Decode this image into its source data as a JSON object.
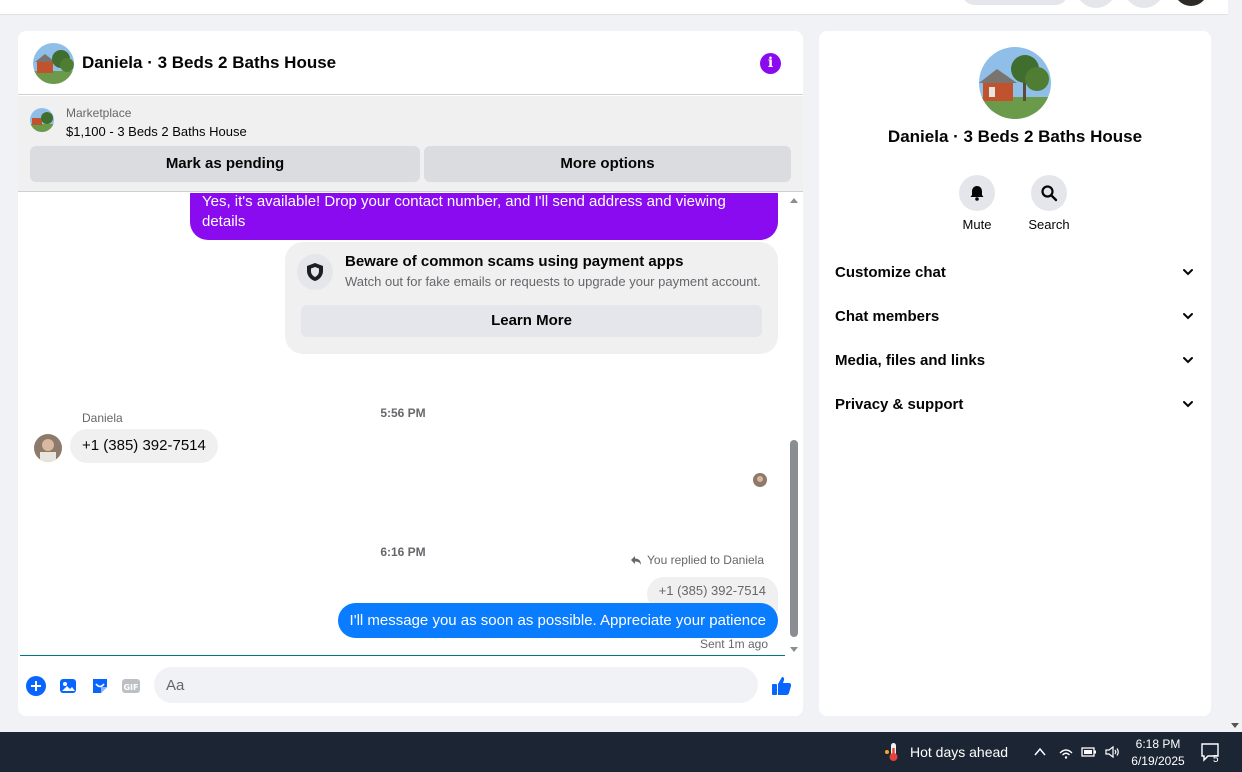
{
  "chat": {
    "title": "Daniela · 3 Beds 2 Baths House",
    "marketplace": {
      "label": "Marketplace",
      "listing": "$1,100 - 3 Beds 2 Baths House",
      "buttons": {
        "pending": "Mark as pending",
        "more": "More options"
      }
    },
    "messages": {
      "outgoing_1": "Yes, it's available! Drop your contact number, and I'll send address and viewing details",
      "scam_notice": {
        "title": "Beware of common scams using payment apps",
        "subtitle": "Watch out for fake emails or requests to upgrade your payment account.",
        "button": "Learn More"
      },
      "time_1": "5:56 PM",
      "sender_name": "Daniela",
      "incoming_1": "+1 (385) 392-7514",
      "time_2": "6:16 PM",
      "reply_context": "You replied to Daniela",
      "quoted": "+1 (385) 392-7514",
      "outgoing_2": "I'll message you as soon as possible. Appreciate your patience",
      "status": "Sent 1m ago"
    },
    "composer": {
      "placeholder": "Aa",
      "icons": [
        "plus-icon",
        "photo-icon",
        "sticker-icon",
        "gif-icon",
        "emoji-icon",
        "like-icon"
      ]
    },
    "accent_color": "#8a0bf0",
    "blue_color": "#0a7cff"
  },
  "info_panel": {
    "name": "Daniela · 3 Beds 2 Baths House",
    "actions": [
      {
        "label": "Mute",
        "icon": "bell-icon"
      },
      {
        "label": "Search",
        "icon": "search-icon"
      }
    ],
    "sections": [
      "Customize chat",
      "Chat members",
      "Media, files and links",
      "Privacy & support"
    ]
  },
  "taskbar": {
    "weather": "Hot days ahead",
    "time": "6:18 PM",
    "date": "6/19/2025",
    "notification_count": "5"
  }
}
